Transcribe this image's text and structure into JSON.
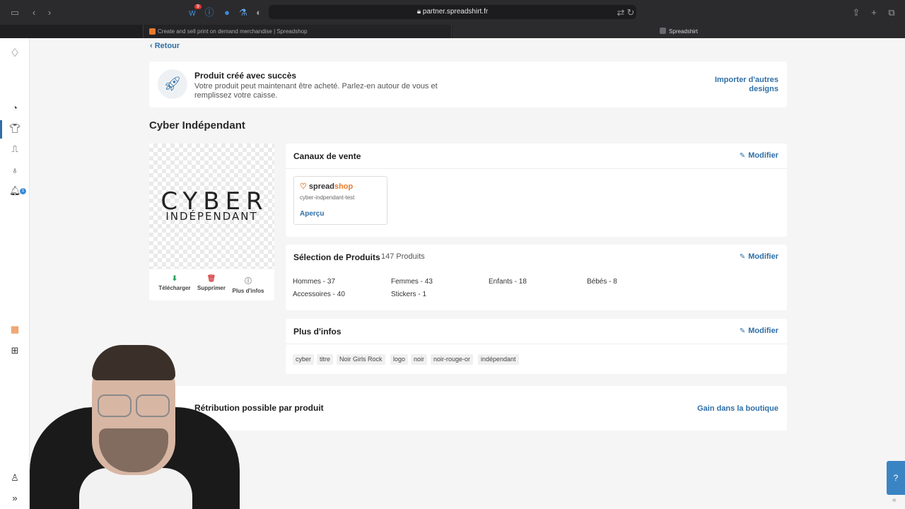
{
  "browser": {
    "url": "partner.spreadshirt.fr",
    "extension_badge": "9",
    "tabs": [
      {
        "title": "Create and sell print on demand merchandise | Spreadshop"
      },
      {
        "title": "Spreadshirt"
      }
    ]
  },
  "nav": {
    "notification_count": "1"
  },
  "back_label": "Retour",
  "success": {
    "title": "Produit créé avec succès",
    "text": "Votre produit peut maintenant être acheté. Parlez-en autour de vous et remplissez votre caisse.",
    "import_link": "Importer d'autres designs"
  },
  "product": {
    "title": "Cyber Indépendant",
    "design_line1": "CYBER",
    "design_line2": "INDÉPENDANT",
    "actions": {
      "download": "Télécharger",
      "delete": "Supprimer",
      "more": "Plus d'infos"
    }
  },
  "channels": {
    "title": "Canaux de vente",
    "modify": "Modifier",
    "shop": {
      "logo_a": "spread",
      "logo_b": "shop",
      "name": "cyber-indpendant-test",
      "preview": "Aperçu"
    }
  },
  "selection": {
    "title": "Sélection de Produits",
    "count": "147 Produits",
    "modify": "Modifier",
    "items": [
      "Hommes - 37",
      "Femmes - 43",
      "Enfants - 18",
      "Bébés - 8",
      "Accessoires - 40",
      "Stickers - 1"
    ]
  },
  "infos": {
    "title": "Plus d'infos",
    "modify": "Modifier",
    "tags": [
      "cyber",
      "titre",
      "Noir Girls Rock",
      "logo",
      "noir",
      "noir-rouge-or",
      "indépendant"
    ]
  },
  "retribution": {
    "title": "Rétribution possible par produit",
    "link": "Gain dans la boutique"
  },
  "colors": {
    "accent": "#2f6fa6",
    "brand_orange": "#e77a2c",
    "success_green": "#2aa55c"
  }
}
